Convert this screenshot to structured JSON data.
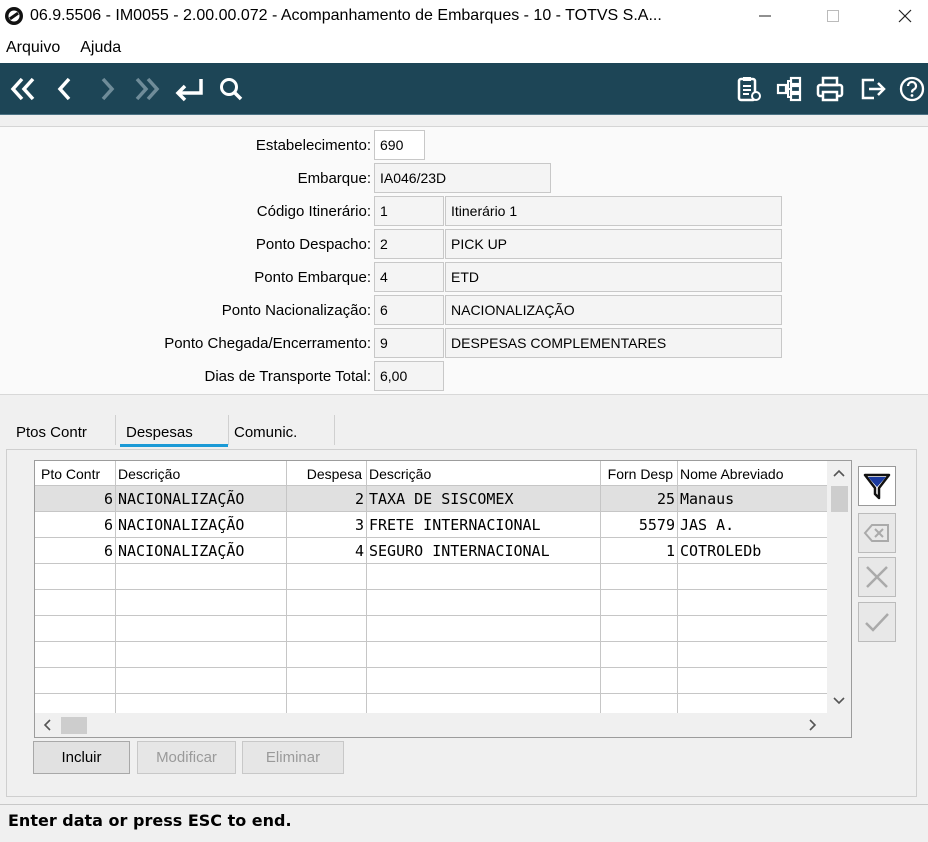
{
  "window": {
    "title": "06.9.5506 - IM0055 - 2.00.00.072 - Acompanhamento de Embarques - 10 - TOTVS S.A...",
    "minimize": "—",
    "maximize": "☐",
    "close": "✕"
  },
  "menu": {
    "arquivo": "Arquivo",
    "ajuda": "Ajuda"
  },
  "toolbar": {
    "icons": [
      "first-record-icon",
      "previous-record-icon",
      "next-record-icon",
      "last-record-icon",
      "go-to-icon",
      "search-icon",
      "clipboard-icon",
      "tree-icon",
      "print-icon",
      "exit-icon",
      "help-icon"
    ],
    "color": "#1d4556"
  },
  "form": {
    "estabelecimento": {
      "label": "Estabelecimento:",
      "value": "690"
    },
    "embarque": {
      "label": "Embarque:",
      "value": "IA046/23D"
    },
    "codigo_itinerario": {
      "label": "Código Itinerário:",
      "code": "1",
      "desc": "Itinerário 1"
    },
    "ponto_despacho": {
      "label": "Ponto Despacho:",
      "code": "2",
      "desc": "PICK UP"
    },
    "ponto_embarque": {
      "label": "Ponto Embarque:",
      "code": "4",
      "desc": "ETD"
    },
    "ponto_nacionalizacao": {
      "label": "Ponto Nacionalização:",
      "code": "6",
      "desc": "NACIONALIZAÇÃO"
    },
    "ponto_chegada": {
      "label": "Ponto Chegada/Encerramento:",
      "code": "9",
      "desc": "DESPESAS COMPLEMENTARES"
    },
    "dias_transporte": {
      "label": "Dias de Transporte Total:",
      "value": "6,00"
    }
  },
  "tabs": [
    "Ptos Contr",
    "Despesas",
    "Comunic."
  ],
  "grid": {
    "headers": [
      "Pto Contr",
      "Descrição",
      "Despesa",
      "Descrição",
      "Forn Desp",
      "Nome Abreviado"
    ],
    "rows": [
      [
        "6",
        "NACIONALIZAÇÃO",
        "2",
        "TAXA DE SISCOMEX",
        "25",
        "Manaus"
      ],
      [
        "6",
        "NACIONALIZAÇÃO",
        "3",
        "FRETE INTERNACIONAL",
        "5579",
        "JAS A."
      ],
      [
        "6",
        "NACIONALIZAÇÃO",
        "4",
        "SEGURO INTERNACIONAL",
        "1",
        "COTROLEDb"
      ]
    ]
  },
  "actions": {
    "incluir": "Incluir",
    "modificar": "Modificar",
    "eliminar": "Eliminar"
  },
  "status": "Enter data or press ESC to end.",
  "colors": {
    "accent": "#1b9ad6",
    "toolbar": "#1d4556"
  }
}
